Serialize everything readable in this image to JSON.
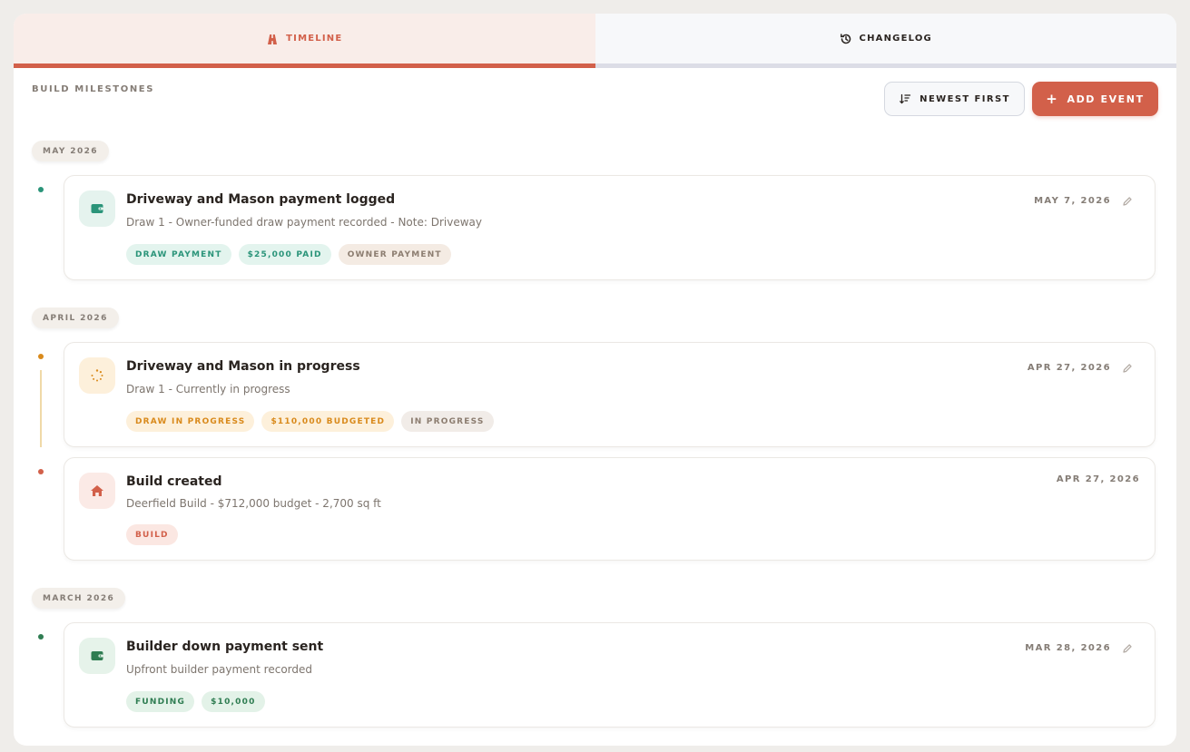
{
  "tabs": {
    "timeline": {
      "label": "TIMELINE",
      "icon": "timeline-icon"
    },
    "changelog": {
      "label": "CHANGELOG",
      "icon": "history-icon"
    }
  },
  "header": {
    "section_title": "BUILD MILESTONES",
    "sort_label": "NEWEST FIRST",
    "add_label": "ADD EVENT"
  },
  "groups": [
    {
      "month": "MAY 2026",
      "events": [
        {
          "title": "Driveway and Mason payment logged",
          "description": "Draw 1 - Owner-funded draw payment recorded - Note: Driveway",
          "date": "MAY 7, 2026",
          "icon": "wallet-icon",
          "tags": [
            "DRAW PAYMENT",
            "$25,000 PAID",
            "OWNER PAYMENT"
          ]
        }
      ]
    },
    {
      "month": "APRIL 2026",
      "events": [
        {
          "title": "Driveway and Mason in progress",
          "description": "Draw 1 - Currently in progress",
          "date": "APR 27, 2026",
          "icon": "loader-icon",
          "tags": [
            "DRAW IN PROGRESS",
            "$110,000 BUDGETED",
            "IN PROGRESS"
          ]
        },
        {
          "title": "Build created",
          "description": "Deerfield Build - $712,000 budget - 2,700 sq ft",
          "date": "APR 27, 2026",
          "icon": "home-icon",
          "tags": [
            "BUILD"
          ]
        }
      ]
    },
    {
      "month": "MARCH 2026",
      "events": [
        {
          "title": "Builder down payment sent",
          "description": "Upfront builder payment recorded",
          "date": "MAR 28, 2026",
          "icon": "wallet-icon",
          "tags": [
            "FUNDING",
            "$10,000"
          ]
        }
      ]
    }
  ],
  "colors": {
    "accent": "#d2604a",
    "teal": "#2a9479",
    "amber": "#d98a1c",
    "green": "#2f7d52",
    "muted": "#857d76"
  }
}
